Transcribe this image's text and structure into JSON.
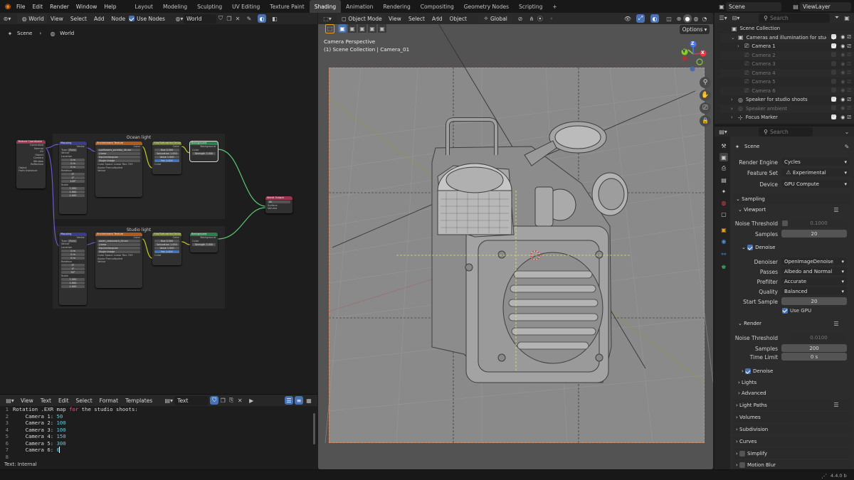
{
  "topbar": {
    "menus": [
      "File",
      "Edit",
      "Render",
      "Window",
      "Help"
    ],
    "workspaces": [
      "Layout",
      "Modeling",
      "Sculpting",
      "UV Editing",
      "Texture Paint",
      "Shading",
      "Animation",
      "Rendering",
      "Compositing",
      "Geometry Nodes",
      "Scripting"
    ],
    "active_workspace": "Shading",
    "add_symbol": "+",
    "scene": "Scene",
    "view_layer": "ViewLayer"
  },
  "node_editor": {
    "header": {
      "type": "World",
      "menus": [
        "View",
        "Select",
        "Add",
        "Node"
      ],
      "use_nodes_label": "Use Nodes",
      "world_name": "World"
    },
    "breadcrumb": {
      "scene": "Scene",
      "world": "World"
    },
    "frames": [
      {
        "label": "Ocean light"
      },
      {
        "label": "Studio light"
      }
    ],
    "nodes": {
      "texcoord": {
        "title": "Texture Coordinate",
        "rows": [
          "Generated",
          "Normal",
          "UV",
          "Object",
          "Camera",
          "Window",
          "Reflection"
        ],
        "object_label": "Object",
        "from_instancer": "From Instancer"
      },
      "mapping": {
        "title": "Mapping",
        "vector": "Vector",
        "type_label": "Type",
        "type_value": "Point",
        "rows": [
          "Vector",
          "Location",
          "X",
          "Y",
          "Z",
          "Rotation",
          "X",
          "Y",
          "Z",
          "Scale",
          "X",
          "Y",
          "Z"
        ],
        "loc": [
          "0 m",
          "0 m",
          "0 m"
        ],
        "rot_ocean": [
          "0°",
          "0°",
          "120°"
        ],
        "rot_studio": [
          "0°",
          "0°",
          "50°"
        ],
        "scale": [
          "1.000",
          "1.000",
          "1.000"
        ]
      },
      "env_ocean": {
        "title": "Environment Texture",
        "image": "sunflowers_puresky_4k.exr",
        "rows": [
          "Linear",
          "Equirectangular",
          "Single Image"
        ],
        "color_space_label": "Color Space",
        "color_space_value": "Linear Rec.709",
        "alpha_label": "Alpha",
        "alpha_value": "Premultiplied",
        "vector": "Vector",
        "color": "Color"
      },
      "env_studio": {
        "title": "Environment Texture",
        "image": "warm_restaurant_4k.exr"
      },
      "huesat": {
        "title": "Hue/Saturation/Value",
        "color": "Color",
        "rows": [
          "Hue",
          "Saturation",
          "Value",
          "Fac"
        ],
        "vals_ocean": [
          "0.500",
          "1.000",
          "1.000",
          "1.000"
        ],
        "vals_studio": [
          "0.500",
          "1.000",
          "1.000",
          "1.000"
        ],
        "color_in": "Color"
      },
      "background": {
        "title": "Background",
        "out": "Background",
        "color": "Color",
        "strength_label": "Strength",
        "strength_ocean": "3.000",
        "strength_studio": "3.000"
      },
      "output": {
        "title": "World Output",
        "target": "All",
        "surface": "Surface",
        "volume": "Volume"
      }
    }
  },
  "text_editor": {
    "menus": [
      "View",
      "Text",
      "Edit",
      "Select",
      "Format",
      "Templates"
    ],
    "text_name": "Text",
    "lines": [
      {
        "num": "1",
        "parts": [
          {
            "t": "Rotation .EXR map ",
            "c": "#d8d8d8"
          },
          {
            "t": "for",
            "c": "#e8599a"
          },
          {
            "t": " the studio shoots:",
            "c": "#d8d8d8"
          }
        ]
      },
      {
        "num": "2",
        "parts": [
          {
            "t": "    Camera 1: ",
            "c": "#d8d8d8"
          },
          {
            "t": "50",
            "c": "#5ec9e6"
          }
        ]
      },
      {
        "num": "3",
        "parts": [
          {
            "t": "    Camera 2: ",
            "c": "#d8d8d8"
          },
          {
            "t": "100",
            "c": "#5ec9e6"
          }
        ]
      },
      {
        "num": "4",
        "parts": [
          {
            "t": "    Camera 3: ",
            "c": "#d8d8d8"
          },
          {
            "t": "100",
            "c": "#5ec9e6"
          }
        ]
      },
      {
        "num": "5",
        "parts": [
          {
            "t": "    Camera 4: ",
            "c": "#d8d8d8"
          },
          {
            "t": "150",
            "c": "#5ec9e6"
          }
        ]
      },
      {
        "num": "6",
        "parts": [
          {
            "t": "    Camera 5: ",
            "c": "#d8d8d8"
          },
          {
            "t": "300",
            "c": "#5ec9e6"
          }
        ]
      },
      {
        "num": "7",
        "parts": [
          {
            "t": "    Camera 6: ",
            "c": "#d8d8d8"
          },
          {
            "t": "0",
            "c": "#5ec9e6"
          }
        ]
      },
      {
        "num": "8",
        "parts": []
      }
    ],
    "status": "Text: Internal"
  },
  "viewport": {
    "mode": "Object Mode",
    "menus": [
      "View",
      "Select",
      "Add",
      "Object"
    ],
    "transform": "Global",
    "options": "Options",
    "overlay_title": "Camera Perspective",
    "overlay_sub": "(1) Scene Collection | Camera_01",
    "gizmo": {
      "x": "X",
      "y": "Y",
      "z": "Z"
    }
  },
  "outliner": {
    "search_placeholder": "Search",
    "rows": [
      {
        "label": "Scene Collection",
        "indent": 0,
        "dim": false,
        "icons": false
      },
      {
        "label": "Cameras and illumination for studio",
        "indent": 1,
        "dim": false,
        "icons": true
      },
      {
        "label": "Camera 1",
        "indent": 2,
        "dim": false,
        "icons": true
      },
      {
        "label": "Camera 2",
        "indent": 2,
        "dim": true,
        "icons": true
      },
      {
        "label": "Camera 3",
        "indent": 2,
        "dim": true,
        "icons": true
      },
      {
        "label": "Camera 4",
        "indent": 2,
        "dim": true,
        "icons": true
      },
      {
        "label": "Camera 5",
        "indent": 2,
        "dim": true,
        "icons": true
      },
      {
        "label": "Camera 6",
        "indent": 2,
        "dim": true,
        "icons": true
      },
      {
        "label": "Speaker for studio shoots",
        "indent": 1,
        "dim": false,
        "icons": true
      },
      {
        "label": "Speaker ambient",
        "indent": 1,
        "dim": true,
        "icons": true
      },
      {
        "label": "Focus Marker",
        "indent": 1,
        "dim": false,
        "icons": true
      }
    ]
  },
  "properties": {
    "search_placeholder": "Search",
    "context": "Scene",
    "render_engine_label": "Render Engine",
    "render_engine": "Cycles",
    "feature_set_label": "Feature Set",
    "feature_set": "Experimental",
    "device_label": "Device",
    "device": "GPU Compute",
    "sampling": "Sampling",
    "viewport": "Viewport",
    "noise_threshold_label": "Noise Threshold",
    "vp_noise_threshold": "0.1000",
    "samples_label": "Samples",
    "vp_samples": "20",
    "denoise": "Denoise",
    "denoiser_label": "Denoiser",
    "denoiser": "OpenImageDenoise",
    "passes_label": "Passes",
    "passes": "Albedo and Normal",
    "prefilter_label": "Prefilter",
    "prefilter": "Accurate",
    "quality_label": "Quality",
    "quality": "Balanced",
    "start_sample_label": "Start Sample",
    "start_sample": "20",
    "use_gpu": "Use GPU",
    "render": "Render",
    "r_noise_threshold": "0.0100",
    "r_samples": "200",
    "time_limit_label": "Time Limit",
    "time_limit": "0 s",
    "r_denoise": "Denoise",
    "lights": "Lights",
    "advanced": "Advanced",
    "light_paths": "Light Paths",
    "volumes": "Volumes",
    "subdivision": "Subdivision",
    "curves": "Curves",
    "simplify": "Simplify",
    "motion_blur": "Motion Blur",
    "version": "4.4.0 b"
  }
}
